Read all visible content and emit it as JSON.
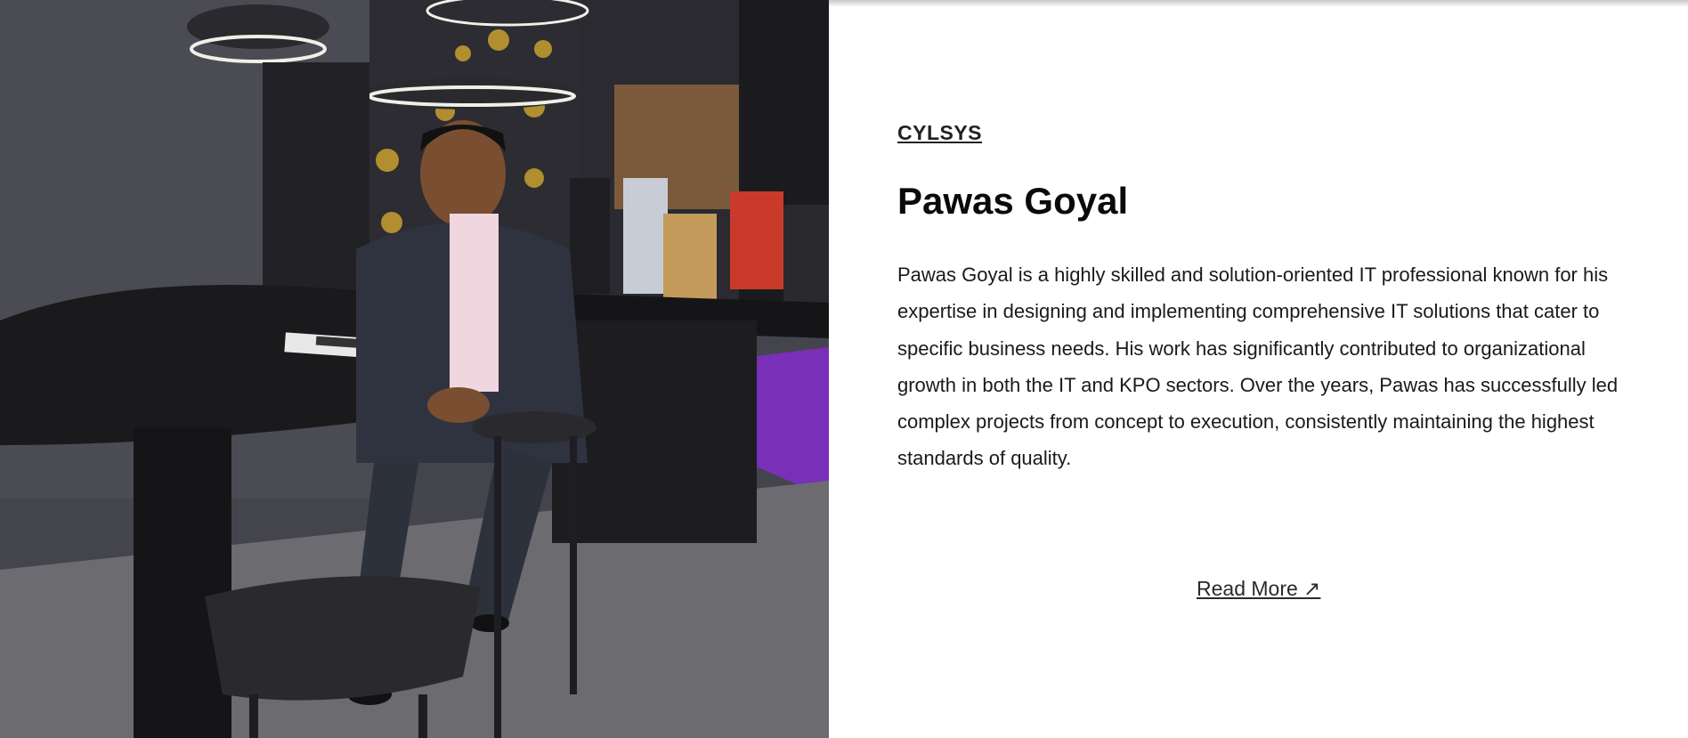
{
  "brand": {
    "label": "CYLSYS"
  },
  "profile": {
    "name": "Pawas Goyal",
    "bio": "Pawas Goyal is a highly skilled and solution-oriented IT professional known for his expertise in designing and implementing comprehensive IT solutions that cater to specific business needs. His work has significantly contributed to organizational growth in both the IT and KPO sectors. Over the years, Pawas has successfully led complex projects from concept to execution, consistently maintaining the highest standards of quality.",
    "read_more": "Read More ↗"
  },
  "photo": {
    "subject": "portrait-photo"
  },
  "colors": {
    "text_primary": "#0a0a0a",
    "text_body": "#1a1a1a",
    "background": "#ffffff",
    "accent_purple": "#7a2fb8",
    "accent_gold": "#d4a82a"
  }
}
